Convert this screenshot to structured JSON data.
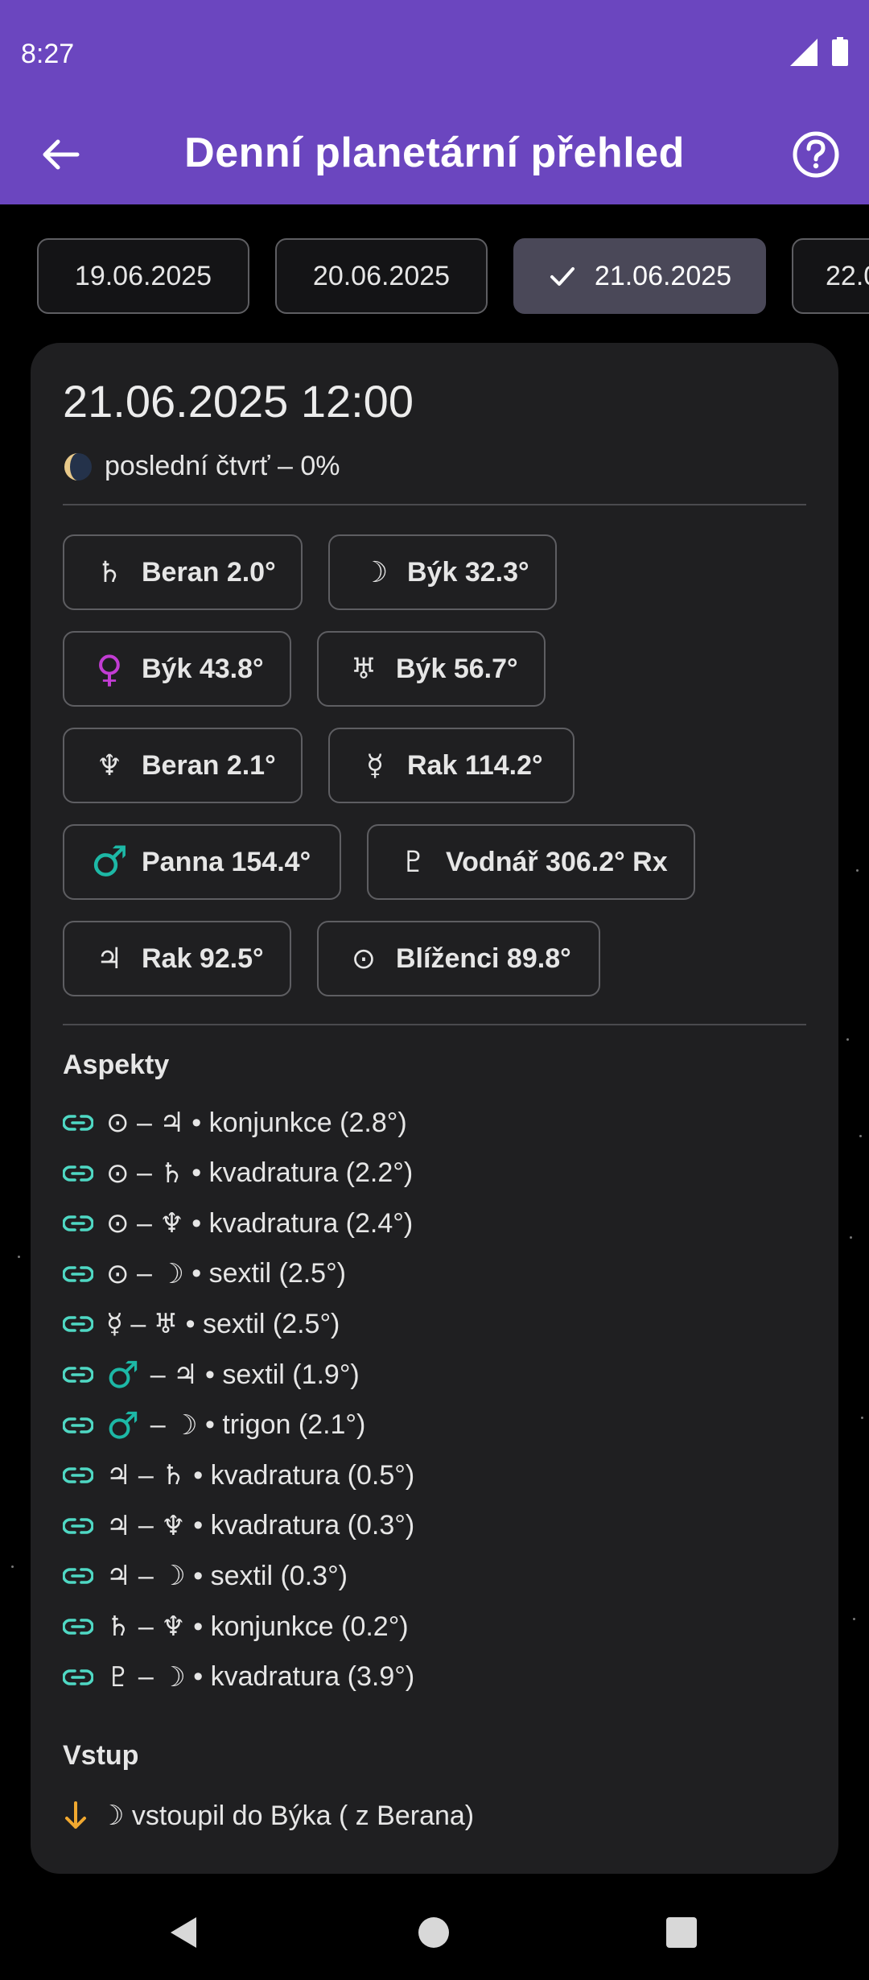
{
  "status_bar": {
    "time": "8:27"
  },
  "app_bar": {
    "title": "Denní planetární přehled"
  },
  "dates": [
    {
      "label": "19.06.2025",
      "selected": false
    },
    {
      "label": "20.06.2025",
      "selected": false
    },
    {
      "label": "21.06.2025",
      "selected": true
    },
    {
      "label": "22.0",
      "selected": false
    }
  ],
  "card": {
    "datetime": "21.06.2025 12:00",
    "moon_phase": "poslední čtvrť – 0%",
    "planets": [
      {
        "symbol": "♄",
        "text": "Beran 2.0°"
      },
      {
        "symbol": "☽",
        "text": "Býk 32.3°"
      },
      {
        "symbol": "♀",
        "text": "Býk 43.8°",
        "color": "#c23cd3"
      },
      {
        "symbol": "♅",
        "text": "Býk 56.7°"
      },
      {
        "symbol": "♆",
        "text": "Beran 2.1°"
      },
      {
        "symbol": "☿",
        "text": "Rak 114.2°"
      },
      {
        "symbol": "♂",
        "text": "Panna 154.4°",
        "color": "#1db8a6"
      },
      {
        "symbol": "♇",
        "text": "Vodnář 306.2° Rx"
      },
      {
        "symbol": "♃",
        "text": "Rak 92.5°"
      },
      {
        "symbol": "⊙",
        "text": "Blíženci 89.8°"
      }
    ],
    "aspects_title": "Aspekty",
    "aspects": [
      {
        "a": "⊙",
        "b": "♃",
        "text": "konjunkce (2.8°)"
      },
      {
        "a": "⊙",
        "b": "♄",
        "text": "kvadratura (2.2°)"
      },
      {
        "a": "⊙",
        "b": "♆",
        "text": "kvadratura (2.4°)"
      },
      {
        "a": "⊙",
        "b": "☽",
        "text": "sextil (2.5°)"
      },
      {
        "a": "☿",
        "b": "♅",
        "text": "sextil (2.5°)"
      },
      {
        "a": "♂",
        "b": "♃",
        "text": "sextil (1.9°)"
      },
      {
        "a": "♂",
        "b": "☽",
        "text": "trigon (2.1°)"
      },
      {
        "a": "♃",
        "b": "♄",
        "text": "kvadratura (0.5°)"
      },
      {
        "a": "♃",
        "b": "♆",
        "text": "kvadratura (0.3°)"
      },
      {
        "a": "♃",
        "b": "☽",
        "text": "sextil (0.3°)"
      },
      {
        "a": "♄",
        "b": "♆",
        "text": "konjunkce (0.2°)"
      },
      {
        "a": "♇",
        "b": "☽",
        "text": "kvadratura (3.9°)"
      }
    ],
    "ingress_title": "Vstup",
    "ingress_text": "☽ vstoupil do Býka ( z Berana)"
  },
  "colors": {
    "primary": "#6b46bf",
    "link_icon": "#4fd8c4",
    "ingress_arrow": "#f0a830",
    "mars": "#1db8a6",
    "venus": "#c23cd3"
  },
  "icons": {
    "back": "arrow-left-icon",
    "help": "help-circle-icon",
    "check": "check-icon",
    "link": "link-icon",
    "ingress": "arrow-down-icon"
  }
}
